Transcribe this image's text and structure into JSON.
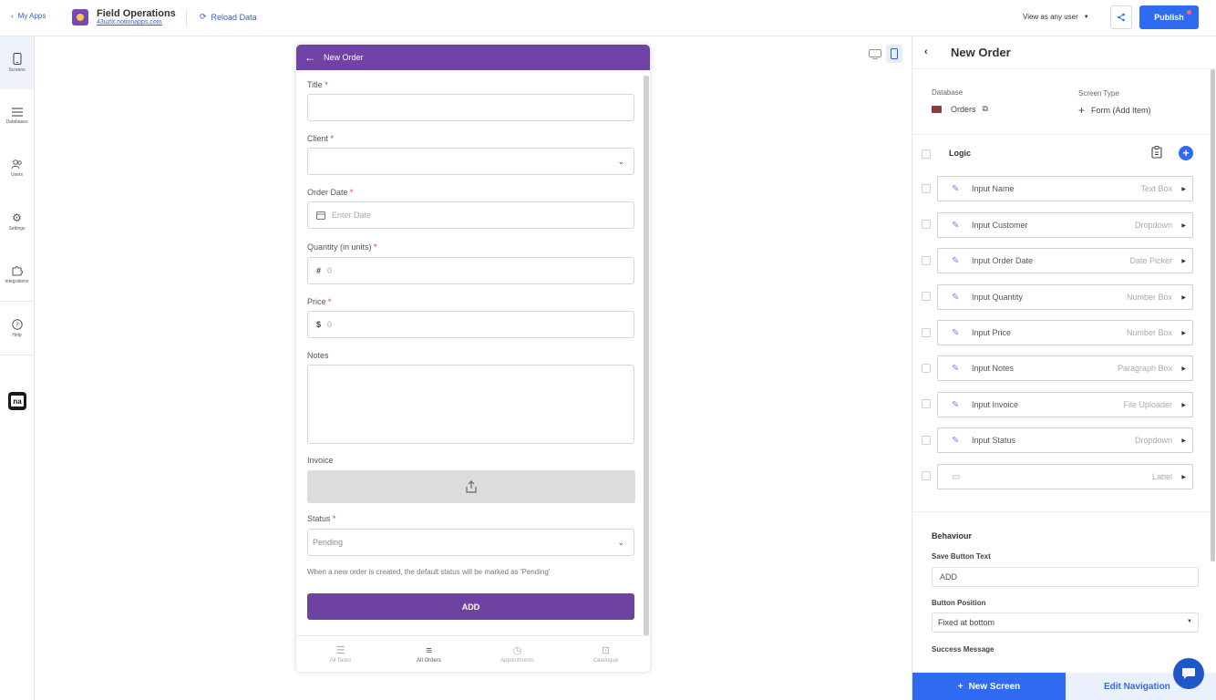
{
  "topbar": {
    "back_label": "My Apps",
    "app_title": "Field Operations",
    "app_url": "43uzlx.notionapps.com",
    "reload_label": "Reload Data",
    "view_as_label": "View as any user",
    "publish_label": "Publish"
  },
  "sidebar": {
    "items": [
      {
        "label": "Screens",
        "icon": "phone-icon"
      },
      {
        "label": "Databases",
        "icon": "list-icon"
      },
      {
        "label": "Users",
        "icon": "users-icon"
      },
      {
        "label": "Settings",
        "icon": "gear-icon"
      },
      {
        "label": "Integrations",
        "icon": "puzzle-icon"
      },
      {
        "label": "Help",
        "icon": "help-icon"
      }
    ],
    "logo_text": "na"
  },
  "preview": {
    "header_title": "New Order",
    "fields": [
      {
        "label": "Title",
        "required": "*",
        "placeholder": ""
      },
      {
        "label": "Client",
        "required": "*",
        "placeholder": ""
      },
      {
        "label": "Order Date",
        "required": "*",
        "placeholder": "Enter Date"
      },
      {
        "label": "Quantity (in units)",
        "required": "*",
        "placeholder": "0",
        "prefix": "#"
      },
      {
        "label": "Price",
        "required": "*",
        "placeholder": "0",
        "prefix": "$"
      },
      {
        "label": "Notes",
        "required": "",
        "placeholder": ""
      },
      {
        "label": "Invoice",
        "required": "",
        "placeholder": ""
      },
      {
        "label": "Status",
        "required": "*",
        "placeholder": "Pending"
      }
    ],
    "status_hint": "When a new order is created, the default status will be marked as 'Pending'",
    "add_button": "ADD",
    "tabs": [
      {
        "label": "All Tasks",
        "icon": "tasks-icon",
        "active": false
      },
      {
        "label": "All Orders",
        "icon": "orders-icon",
        "active": true
      },
      {
        "label": "Appointments",
        "icon": "clock-icon",
        "active": false
      },
      {
        "label": "Catalogue",
        "icon": "bag-icon",
        "active": false
      }
    ]
  },
  "panel": {
    "title": "New Order",
    "database_label": "Database",
    "database_value": "Orders",
    "screen_type_label": "Screen Type",
    "screen_type_value": "Form (Add Item)",
    "logic_label": "Logic",
    "components": [
      {
        "name": "Input Name",
        "type": "Text Box"
      },
      {
        "name": "Input Customer",
        "type": "Dropdown"
      },
      {
        "name": "Input Order Date",
        "type": "Date Picker"
      },
      {
        "name": "Input Quantity",
        "type": "Number Box"
      },
      {
        "name": "Input Price",
        "type": "Number Box"
      },
      {
        "name": "Input Notes",
        "type": "Paragraph Box"
      },
      {
        "name": "Input Invoice",
        "type": "File Uploader"
      },
      {
        "name": "Input Status",
        "type": "Dropdown"
      },
      {
        "name": "",
        "type": "Label"
      }
    ],
    "behaviour_label": "Behaviour",
    "save_button_text_label": "Save Button Text",
    "save_button_text_value": "ADD",
    "button_position_label": "Button Position",
    "button_position_value": "Fixed at bottom",
    "success_message_label": "Success Message",
    "new_screen_label": "New Screen",
    "edit_navigation_label": "Edit Navigation"
  },
  "colors": {
    "accent_blue": "#2f6bf0",
    "form_purple": "#7043a6"
  }
}
